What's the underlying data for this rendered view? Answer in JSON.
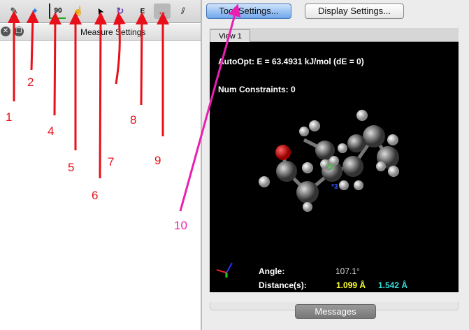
{
  "left_panel": {
    "tools": [
      {
        "name": "draw-tool",
        "icon": "pencil-icon",
        "glyph": "✎"
      },
      {
        "name": "navigate-tool",
        "icon": "four-point-star-icon",
        "glyph": "✦"
      },
      {
        "name": "bond-centric-tool",
        "icon": "angle-90-icon",
        "glyph": "90"
      },
      {
        "name": "manipulate-tool",
        "icon": "hand-icon",
        "glyph": "☝"
      },
      {
        "name": "select-tool",
        "icon": "cursor-arrow-icon",
        "glyph": "➤"
      },
      {
        "name": "auto-rotate-tool",
        "icon": "rotate-icon",
        "glyph": "↻"
      },
      {
        "name": "auto-optimize-tool",
        "icon": "energy-e-icon",
        "glyph": "E"
      },
      {
        "name": "measure-tool",
        "icon": "ruler-icon",
        "glyph": "↔"
      },
      {
        "name": "align-tool",
        "icon": "align-icon",
        "glyph": "⫽"
      }
    ],
    "settings_title": "Measure Settings"
  },
  "header": {
    "tool_settings": "Tool Settings...",
    "display_settings": "Display Settings..."
  },
  "view": {
    "tab": "View 1",
    "autoopt": "AutoOpt: E = 63.4931 kJ/mol (dE = 0)",
    "constraints": "Num Constraints: 0",
    "angle_label": "Angle:",
    "angle_value": "107.1°",
    "distance_label": "Distance(s):",
    "distance1": "1.099 Å",
    "distance2": "1.542 Å",
    "atom_labels": [
      "*2",
      "*3"
    ]
  },
  "messages": "Messages",
  "annotations": [
    "1",
    "2",
    "4",
    "5",
    "6",
    "7",
    "8",
    "9",
    "10"
  ],
  "colors": {
    "arrow": "#e8101a",
    "magenta": "#ea1fb0",
    "dist1": "#ffff33",
    "dist2": "#33dddd"
  }
}
